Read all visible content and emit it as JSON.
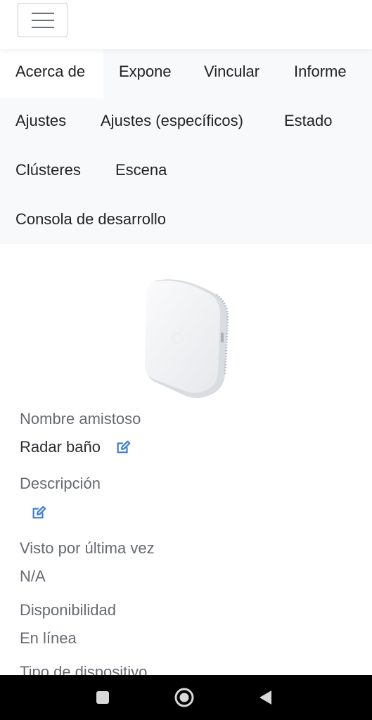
{
  "tabs": [
    {
      "label": "Acerca de",
      "active": true
    },
    {
      "label": "Expone"
    },
    {
      "label": "Vincular"
    },
    {
      "label": "Informe"
    },
    {
      "label": "Ajustes"
    },
    {
      "label": "Ajustes (específicos)"
    },
    {
      "label": "Estado"
    },
    {
      "label": "Clústeres"
    },
    {
      "label": "Escena"
    },
    {
      "label": "Consola de desarrollo"
    }
  ],
  "device": {
    "image_icon": "device-image",
    "fields": [
      {
        "label": "Nombre amistoso",
        "value": "Radar baño",
        "editable": true
      },
      {
        "label": "Descripción",
        "value": "",
        "editable": true
      },
      {
        "label": "Visto por última vez",
        "value": "N/A"
      },
      {
        "label": "Disponibilidad",
        "value": "En línea"
      },
      {
        "label": "Tipo de dispositivo",
        "value": ""
      }
    ]
  },
  "colors": {
    "accent": "#3a7bd5",
    "tabs_bg": "#f8f9fb",
    "label_text": "#666a70"
  },
  "icons": {
    "menu": "hamburger-menu-icon",
    "edit": "edit-icon",
    "nav_recent": "square-icon",
    "nav_home": "circle-icon",
    "nav_back": "triangle-back-icon"
  }
}
